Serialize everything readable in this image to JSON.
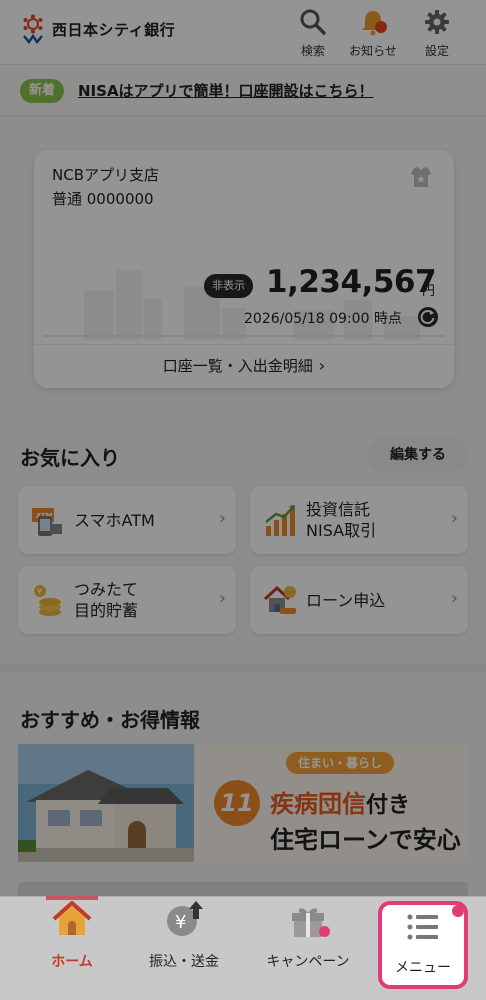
{
  "header": {
    "bank_name": "西日本シティ銀行",
    "search_label": "検索",
    "notice_label": "お知らせ",
    "settings_label": "設定"
  },
  "news": {
    "tag": "新着",
    "text": "NISAはアプリで簡単！口座開設はこちら！"
  },
  "account": {
    "branch": "NCBアプリ支店",
    "number": "普通 0000000",
    "hide_label": "非表示",
    "balance": "1,234,567",
    "unit": "円",
    "timestamp": "2026/05/18 09:00 時点",
    "link_label": "口座一覧・入出金明細"
  },
  "favorites": {
    "title": "お気に入り",
    "edit_label": "編集する",
    "items": [
      {
        "line1": "スマホATM",
        "line2": "",
        "icon": "atm-icon"
      },
      {
        "line1": "投資信託",
        "line2": "NISA取引",
        "icon": "investment-chart-icon"
      },
      {
        "line1": "つみたて",
        "line2": "目的貯蓄",
        "icon": "coin-stack-icon"
      },
      {
        "line1": "ローン申込",
        "line2": "",
        "icon": "house-loan-icon"
      }
    ]
  },
  "recommend": {
    "title": "おすすめ・お得情報",
    "banner_tag": "住まい・暮らし",
    "banner_badge": "11",
    "banner_line1_highlight": "疾病団信",
    "banner_line1_after": "付き",
    "banner_line2": "住宅ローンで安心"
  },
  "tabbar": {
    "home": "ホーム",
    "transfer": "振込・送金",
    "campaign": "キャンペーン",
    "menu": "メニュー",
    "active": "home"
  },
  "colors": {
    "accent_pink": "#e23b78",
    "home_red": "#c0392b",
    "news_green": "#8bc34a",
    "banner_orange": "#f08a2e"
  }
}
